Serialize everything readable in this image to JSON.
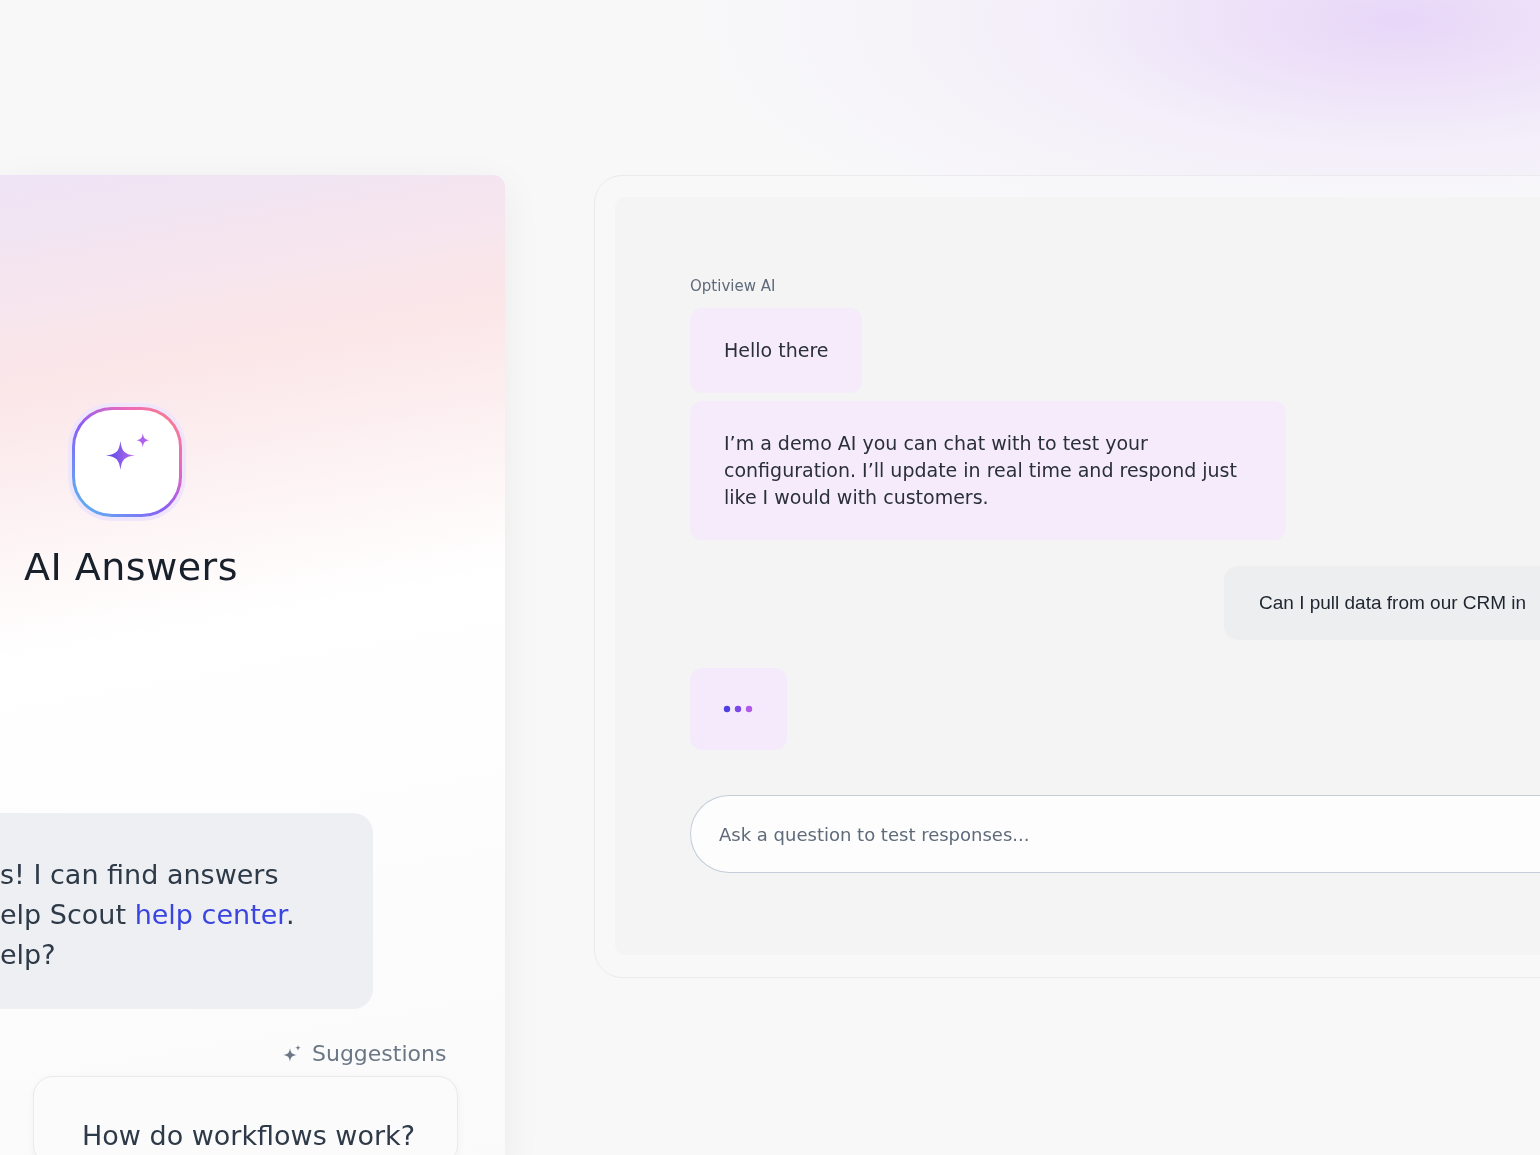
{
  "intro_card": {
    "title": "AI Answers",
    "bot_message": {
      "lines": [
        {
          "text": "s! I can find answers"
        },
        {
          "text": "elp Scout ",
          "link": "help center",
          "after": "."
        },
        {
          "text": "elp?"
        }
      ]
    },
    "suggestions_label": "Suggestions",
    "suggestions": [
      "How do workflows work?"
    ]
  },
  "chat_preview": {
    "sender": "Optiview AI",
    "messages": [
      {
        "kind": "bot",
        "text": "Hello there"
      },
      {
        "kind": "bot",
        "text": "I’m a demo AI you can chat with to test your configuration. I’ll update in real time and respond just like I would with customers."
      },
      {
        "kind": "user",
        "text": "Can I pull data from our CRM in"
      },
      {
        "kind": "typing"
      }
    ],
    "input": {
      "placeholder": "Ask a question to test responses..."
    }
  }
}
